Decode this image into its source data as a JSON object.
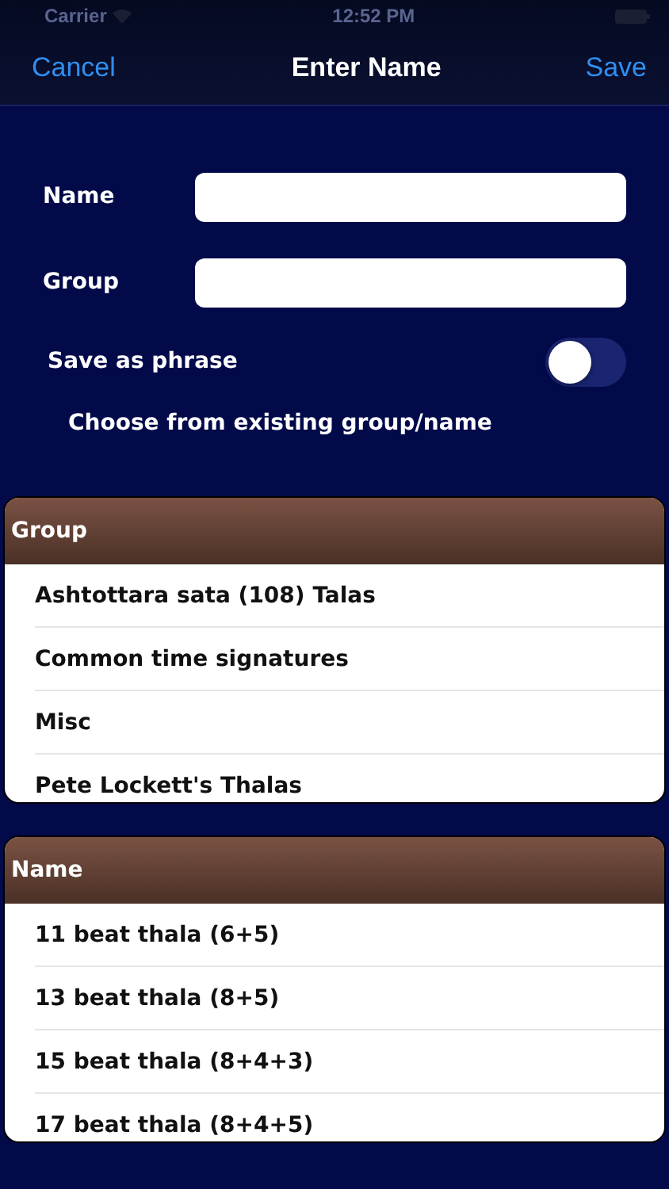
{
  "status_bar": {
    "carrier": "Carrier",
    "time": "12:52 PM"
  },
  "nav": {
    "cancel": "Cancel",
    "title": "Enter Name",
    "save": "Save"
  },
  "form": {
    "fields": [
      {
        "label": "Name"
      },
      {
        "label": "Group"
      }
    ],
    "toggle": {
      "label": "Save as phrase",
      "on": false
    },
    "hint": "Choose from existing group/name"
  },
  "tables": [
    {
      "header": "Group",
      "rows": [
        "Ashtottara sata (108) Talas",
        "Common time signatures",
        "Misc",
        "Pete Lockett's Thalas"
      ]
    },
    {
      "header": "Name",
      "rows": [
        "11 beat thala (6+5)",
        "13 beat thala (8+5)",
        "15 beat thala (8+4+3)",
        "17 beat thala (8+4+5)"
      ]
    }
  ]
}
